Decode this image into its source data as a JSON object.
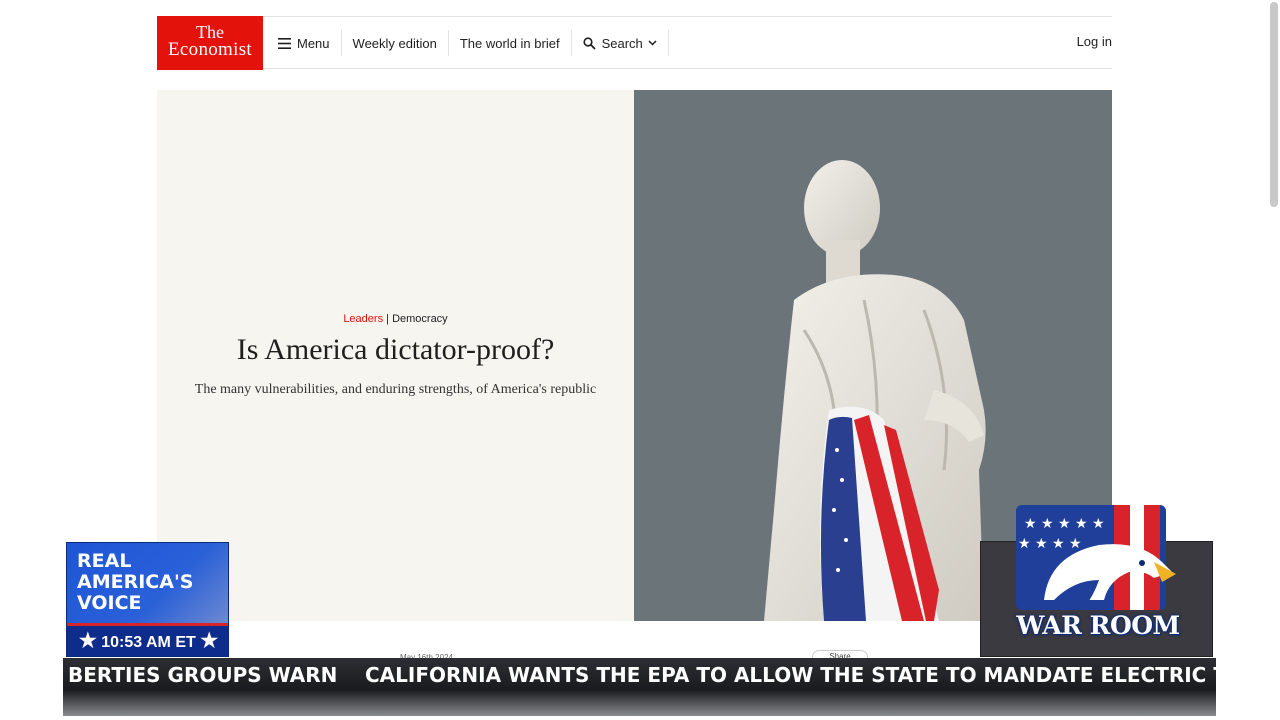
{
  "header": {
    "logo_line1": "The",
    "logo_line2": "Economist",
    "nav": [
      {
        "label": "Menu",
        "icon": "hamburger-icon"
      },
      {
        "label": "Weekly edition"
      },
      {
        "label": "The world in brief"
      },
      {
        "label": "Search",
        "icon": "search-icon"
      }
    ],
    "login_label": "Log in"
  },
  "article": {
    "section": "Leaders",
    "separator": "|",
    "topic": "Democracy",
    "headline": "Is America dictator-proof?",
    "subheadline": "The many vulnerabilities, and enduring strengths, of America's republic",
    "date": "May 16th 2024",
    "share_label": "Share"
  },
  "overlay": {
    "rav_logo": [
      "REAL",
      "AMERICA'S",
      "VOICE"
    ],
    "rav_time": "10:53 AM ET",
    "war_room_label": "WAR ROOM",
    "ticker_left": "BERTIES GROUPS WARN",
    "ticker_right": "CALIFORNIA WANTS THE EPA TO ALLOW THE STATE TO MANDATE ELECTRIC TRAI"
  },
  "colors": {
    "brand_red": "#e3120b",
    "hero_left_bg": "#f6f5ef",
    "hero_right_bg": "#6b7479",
    "rav_blue": "#1d4fc4"
  }
}
